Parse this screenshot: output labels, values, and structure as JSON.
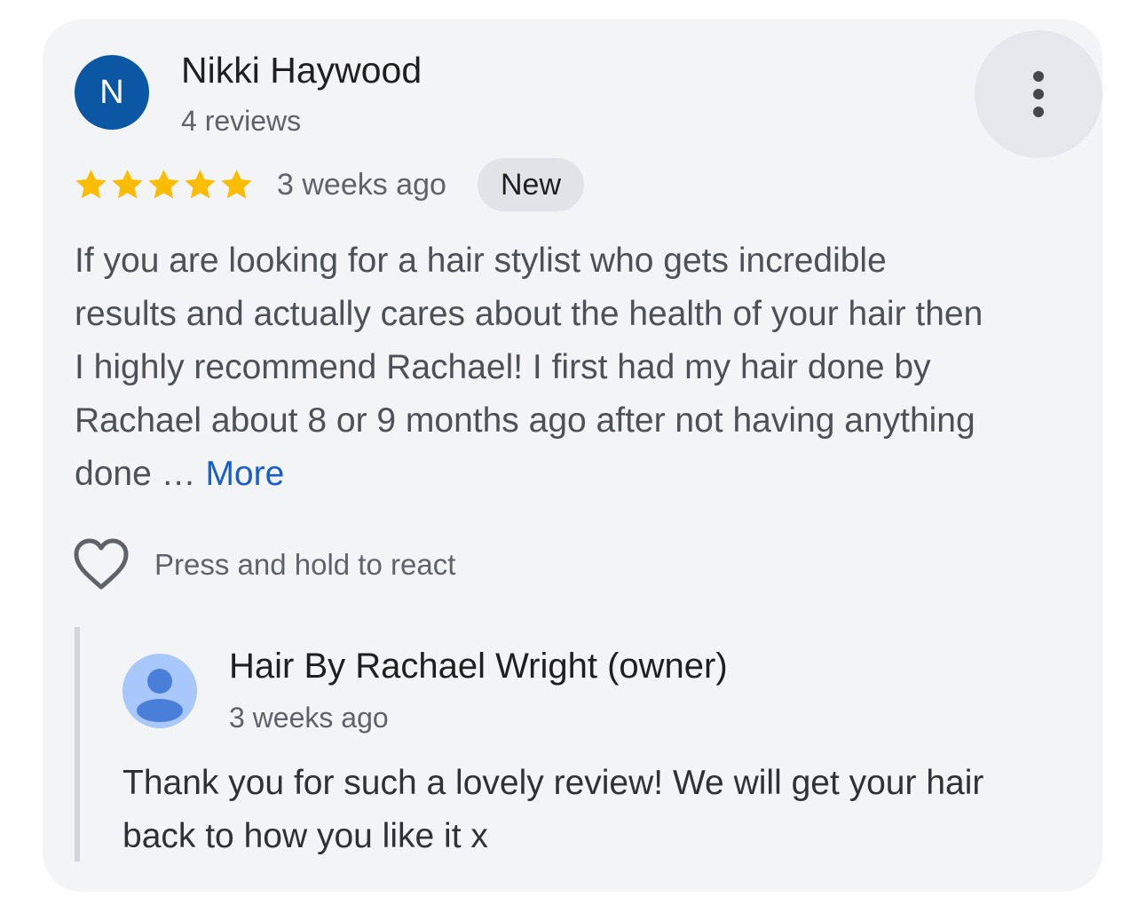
{
  "review": {
    "avatar_letter": "N",
    "avatar_color": "#0b57a4",
    "reviewer_name": "Nikki Haywood",
    "review_count": "4 reviews",
    "rating": 5,
    "rating_max": 5,
    "star_color": "#fbbc04",
    "date": "3 weeks ago",
    "badge": "New",
    "text_lines": [
      "If you are looking for a hair stylist who gets incredible",
      "results and actually cares about the health of your hair then",
      "I highly recommend Rachael! I first had my hair done by",
      "Rachael about 8 or 9 months ago after not having anything",
      "done … "
    ],
    "more_label": "More",
    "more_color": "#1a5fc9",
    "react_icon": "heart-outline-icon",
    "react_hint": "Press and hold to react",
    "menu_icon": "more-vert-icon"
  },
  "owner_reply": {
    "avatar_icon": "default-profile-icon",
    "name": "Hair By Rachael Wright (owner)",
    "date": "3 weeks ago",
    "text_lines": [
      "Thank you for such a lovely review! We will get your hair",
      "back to how you like it x"
    ]
  }
}
